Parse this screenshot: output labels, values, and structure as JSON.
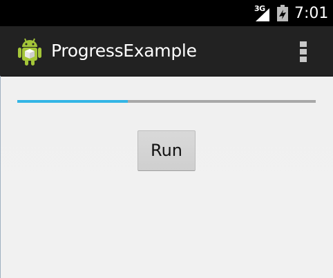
{
  "status_bar": {
    "network": "3G",
    "time": "7:01",
    "icons": [
      "signal-icon",
      "battery-icon"
    ]
  },
  "action_bar": {
    "title": "ProgressExample",
    "app_icon": "android-icon",
    "overflow_icon": "overflow-menu-icon"
  },
  "main": {
    "progress_fraction": 0.37,
    "run_label": "Run"
  },
  "colors": {
    "accent": "#33b5e5",
    "track": "#a8a8a8",
    "action_bar_bg": "#222222",
    "status_bar_bg": "#000000",
    "android_green": "#a4c639"
  }
}
